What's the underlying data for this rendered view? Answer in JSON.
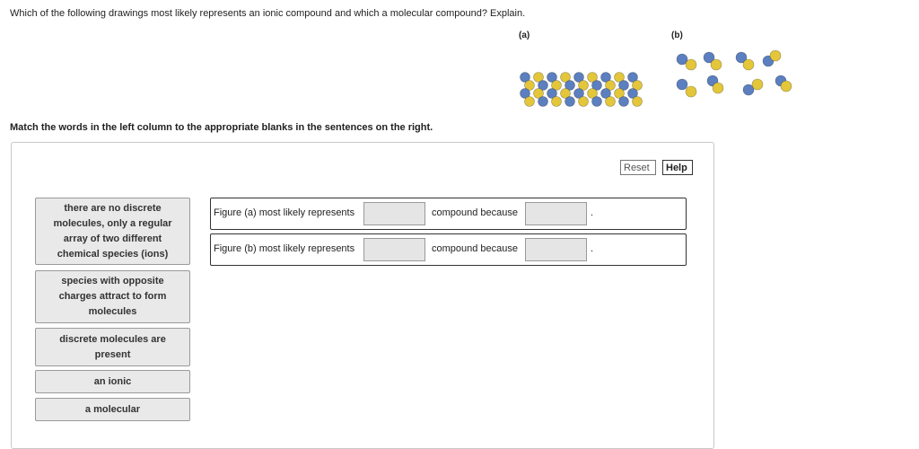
{
  "question": "Which of the following drawings most likely represents an ionic compound and which a molecular compound? Explain.",
  "figures": {
    "a_label": "(a)",
    "b_label": "(b)"
  },
  "colors": {
    "yellow": "#e3c63a",
    "blue": "#5b7fbf"
  },
  "instructions": "Match the words in the left column to the appropriate blanks in the sentences on the right.",
  "buttons": {
    "reset": "Reset",
    "help": "Help"
  },
  "word_bank": [
    {
      "text": "there are no discrete molecules, only a regular array of two different chemical species (ions)"
    },
    {
      "text": "species with opposite charges attract to form molecules"
    },
    {
      "text": "discrete molecules are present"
    },
    {
      "text": "an ionic"
    },
    {
      "text": "a molecular"
    }
  ],
  "sentences": [
    {
      "before": "Figure (a) most likely represents",
      "middle": "compound because",
      "end": "."
    },
    {
      "before": "Figure (b) most likely represents",
      "middle": "compound because",
      "end": "."
    }
  ]
}
